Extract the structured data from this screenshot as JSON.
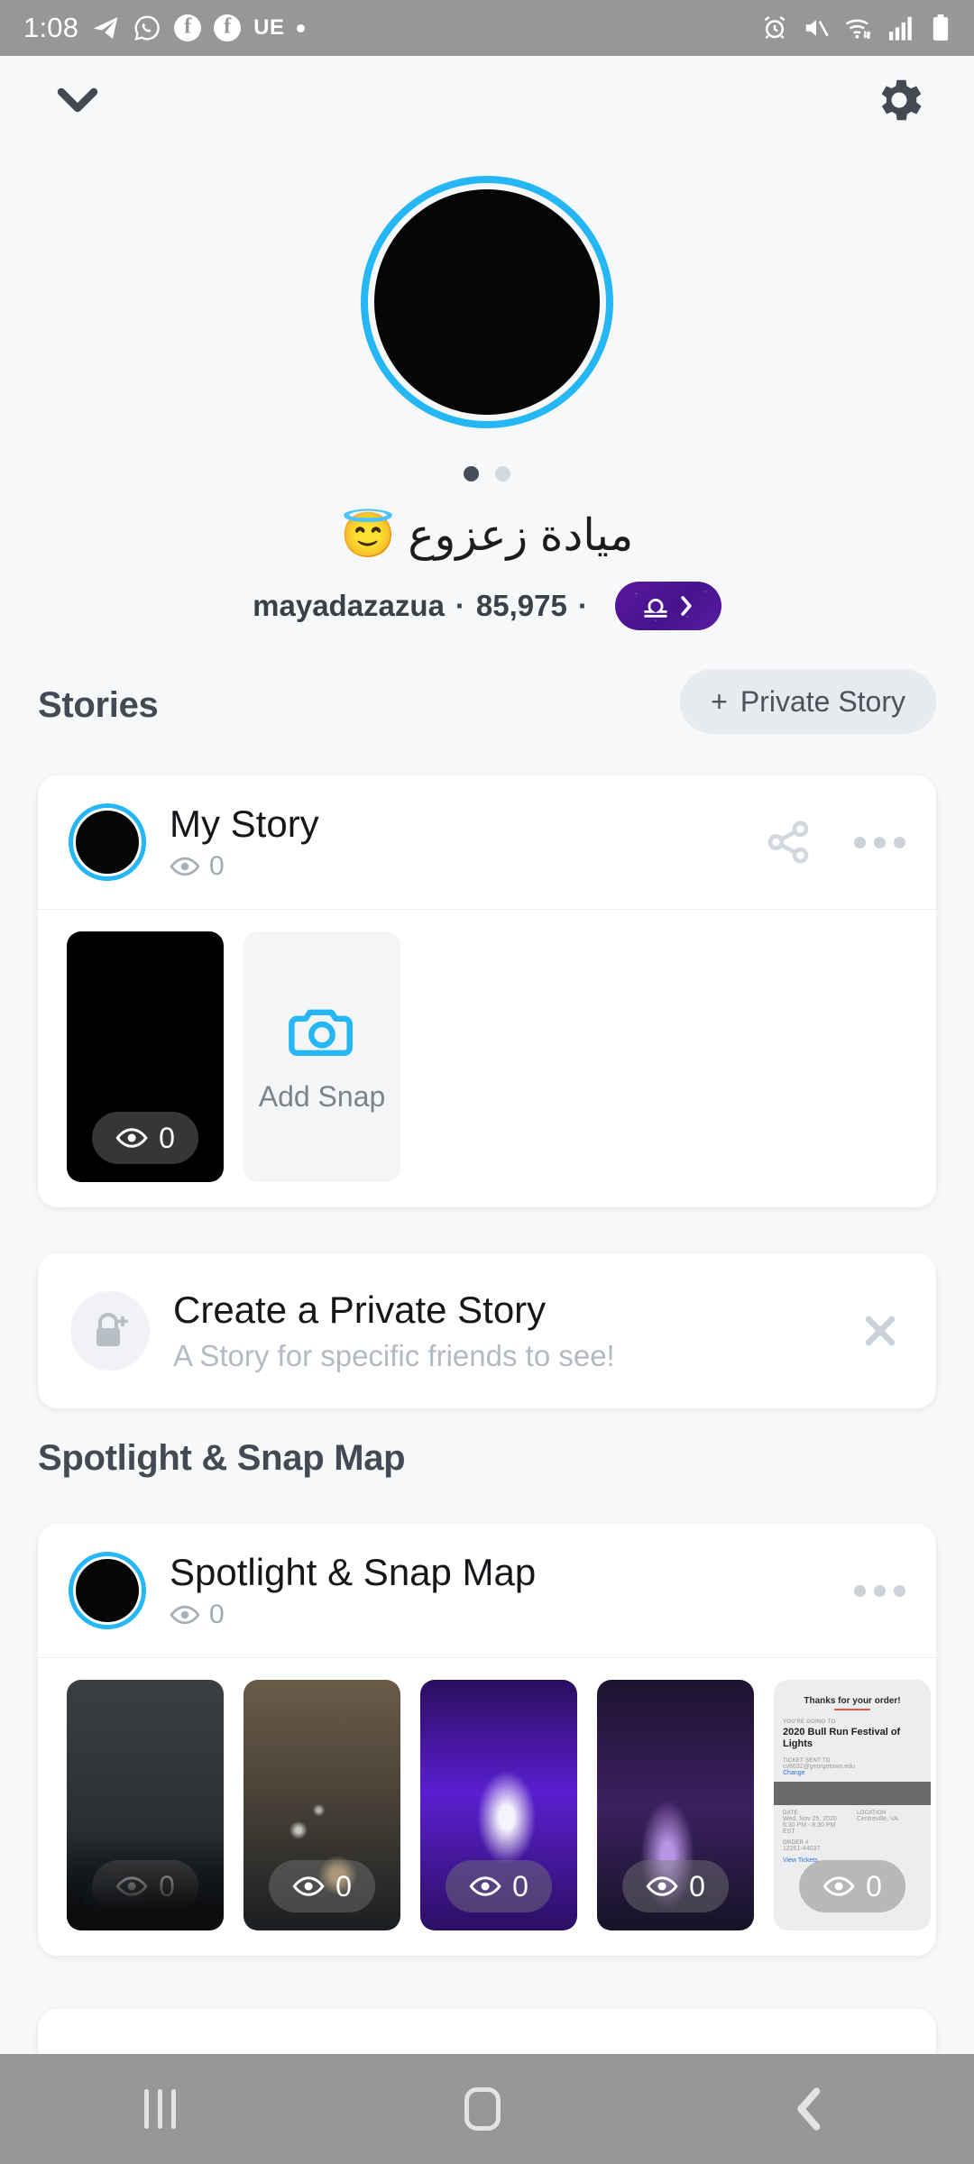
{
  "status_bar": {
    "time": "1:08",
    "left_icons": [
      "telegram-icon",
      "whatsapp-icon",
      "facebook-icon",
      "facebook-icon"
    ],
    "carrier_label": "UE",
    "right_icons": [
      "alarm-icon",
      "mute-icon",
      "wifi-icon",
      "signal-icon",
      "battery-icon"
    ]
  },
  "top_bar": {
    "collapse_icon": "chevron-down-icon",
    "settings_icon": "gear-icon"
  },
  "profile": {
    "avatar": "profile-avatar",
    "page_dots": [
      "active",
      "inactive"
    ],
    "display_name": "ميادة زعزوع 😇",
    "username": "mayadazazua",
    "snapscore": "85,975",
    "separator": "·",
    "zodiac_sign": "libra-icon",
    "zodiac_chevron": "chevron-right-icon",
    "zodiac_color": "#4E169A"
  },
  "stories": {
    "heading": "Stories",
    "private_story_button": {
      "plus": "+",
      "label": "Private Story"
    },
    "my_story": {
      "title": "My Story",
      "views_icon": "eye-icon",
      "views": "0",
      "share_icon": "share-icon",
      "more_icon": "more-options-icon",
      "snaps": [
        {
          "name": "snap-thumbnail-black",
          "views": "0"
        }
      ],
      "add_snap": {
        "icon": "camera-icon",
        "label": "Add Snap"
      }
    },
    "create_private_story": {
      "icon": "lock-plus-icon",
      "title": "Create a Private Story",
      "subtitle": "A Story for specific friends to see!",
      "close_icon": "close-icon"
    }
  },
  "spotlight": {
    "heading": "Spotlight & Snap Map",
    "row": {
      "title": "Spotlight & Snap Map",
      "views_icon": "eye-icon",
      "views": "0",
      "more_icon": "more-options-icon"
    },
    "thumbnails": [
      {
        "name": "night-trees-thumbnail",
        "views": "0"
      },
      {
        "name": "road-lights-thumbnail",
        "views": "0"
      },
      {
        "name": "purple-light-display-thumbnail",
        "views": "0"
      },
      {
        "name": "purple-night-thumbnail",
        "views": "0"
      },
      {
        "name": "order-receipt-thumbnail",
        "views": "0"
      }
    ],
    "receipt": {
      "thanks": "Thanks for your order!",
      "going_label": "YOU'RE GOING TO",
      "event_title": "2020 Bull Run Festival of Lights",
      "ticket_label": "TICKET SENT TO",
      "ticket_email": "cv6632@georgetown.edu",
      "change_link": "Change",
      "date_label": "DATE",
      "date_value": "Wed, Nov 25, 2020 6:30 PM - 8:30 PM EST",
      "location_label": "LOCATION",
      "location_value": "Centreville, VA",
      "order_label": "ORDER #",
      "order_value": "12261-44037",
      "view_tickets": "View Tickets"
    }
  },
  "nav_bar": {
    "recents_icon": "recents-icon",
    "home_icon": "home-icon",
    "back_icon": "back-icon"
  },
  "colors": {
    "accent_blue": "#25B7F5",
    "background": "#F7F8F9",
    "card": "#FFFFFF",
    "heading": "#434A54"
  }
}
